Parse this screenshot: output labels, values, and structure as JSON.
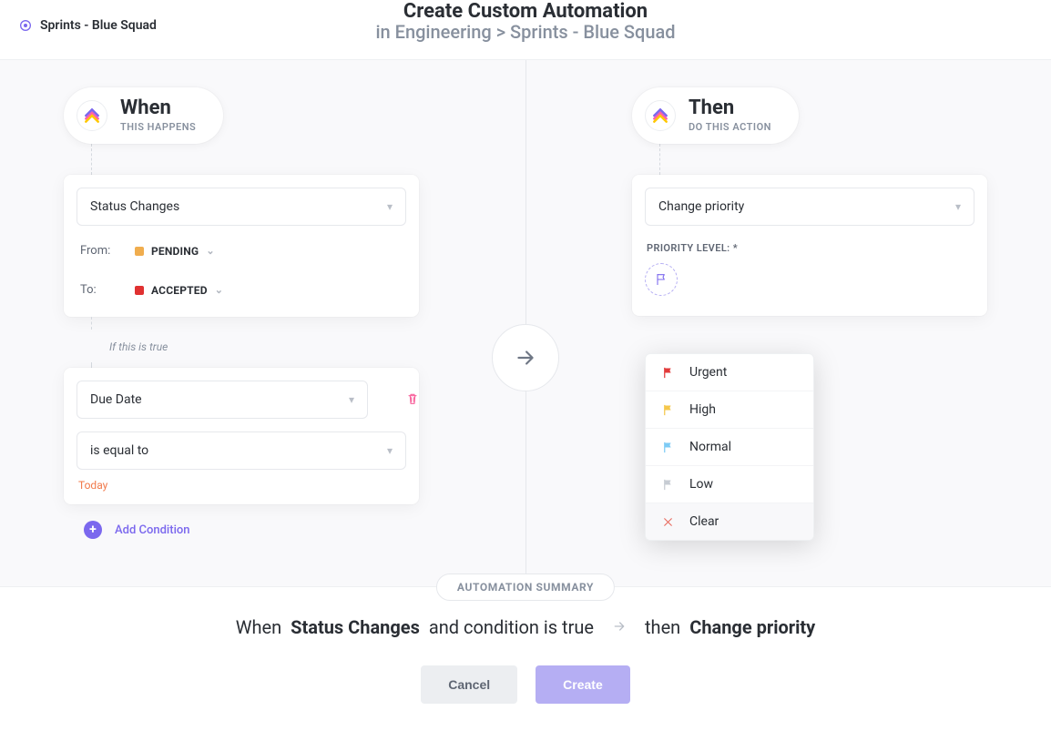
{
  "breadcrumb": {
    "label": "Sprints - Blue Squad"
  },
  "title": {
    "main": "Create Custom Automation",
    "sub": "in Engineering > Sprints - Blue Squad"
  },
  "when": {
    "heading": "When",
    "subheading": "THIS HAPPENS",
    "trigger": "Status Changes",
    "from_label": "From:",
    "from_status": "PENDING",
    "from_color": "#f0ad4e",
    "to_label": "To:",
    "to_status": "ACCEPTED",
    "to_color": "#e03131",
    "condition_intro": "If this is true",
    "condition_field": "Due Date",
    "condition_operator": "is equal to",
    "condition_value": "Today",
    "add_condition": "Add Condition"
  },
  "then": {
    "heading": "Then",
    "subheading": "DO THIS ACTION",
    "action": "Change priority",
    "priority_label": "PRIORITY LEVEL: *",
    "options": [
      {
        "label": "Urgent",
        "color": "#e23b3b"
      },
      {
        "label": "High",
        "color": "#f5c74b"
      },
      {
        "label": "Normal",
        "color": "#7ecbf5"
      },
      {
        "label": "Low",
        "color": "#c7ccd3"
      },
      {
        "label": "Clear",
        "color": "#e86a5e"
      }
    ]
  },
  "summary": {
    "chip": "AUTOMATION SUMMARY",
    "when_prefix": "When",
    "trigger": "Status Changes",
    "and": "and condition is true",
    "then_prefix": "then",
    "action": "Change priority"
  },
  "buttons": {
    "cancel": "Cancel",
    "create": "Create"
  }
}
